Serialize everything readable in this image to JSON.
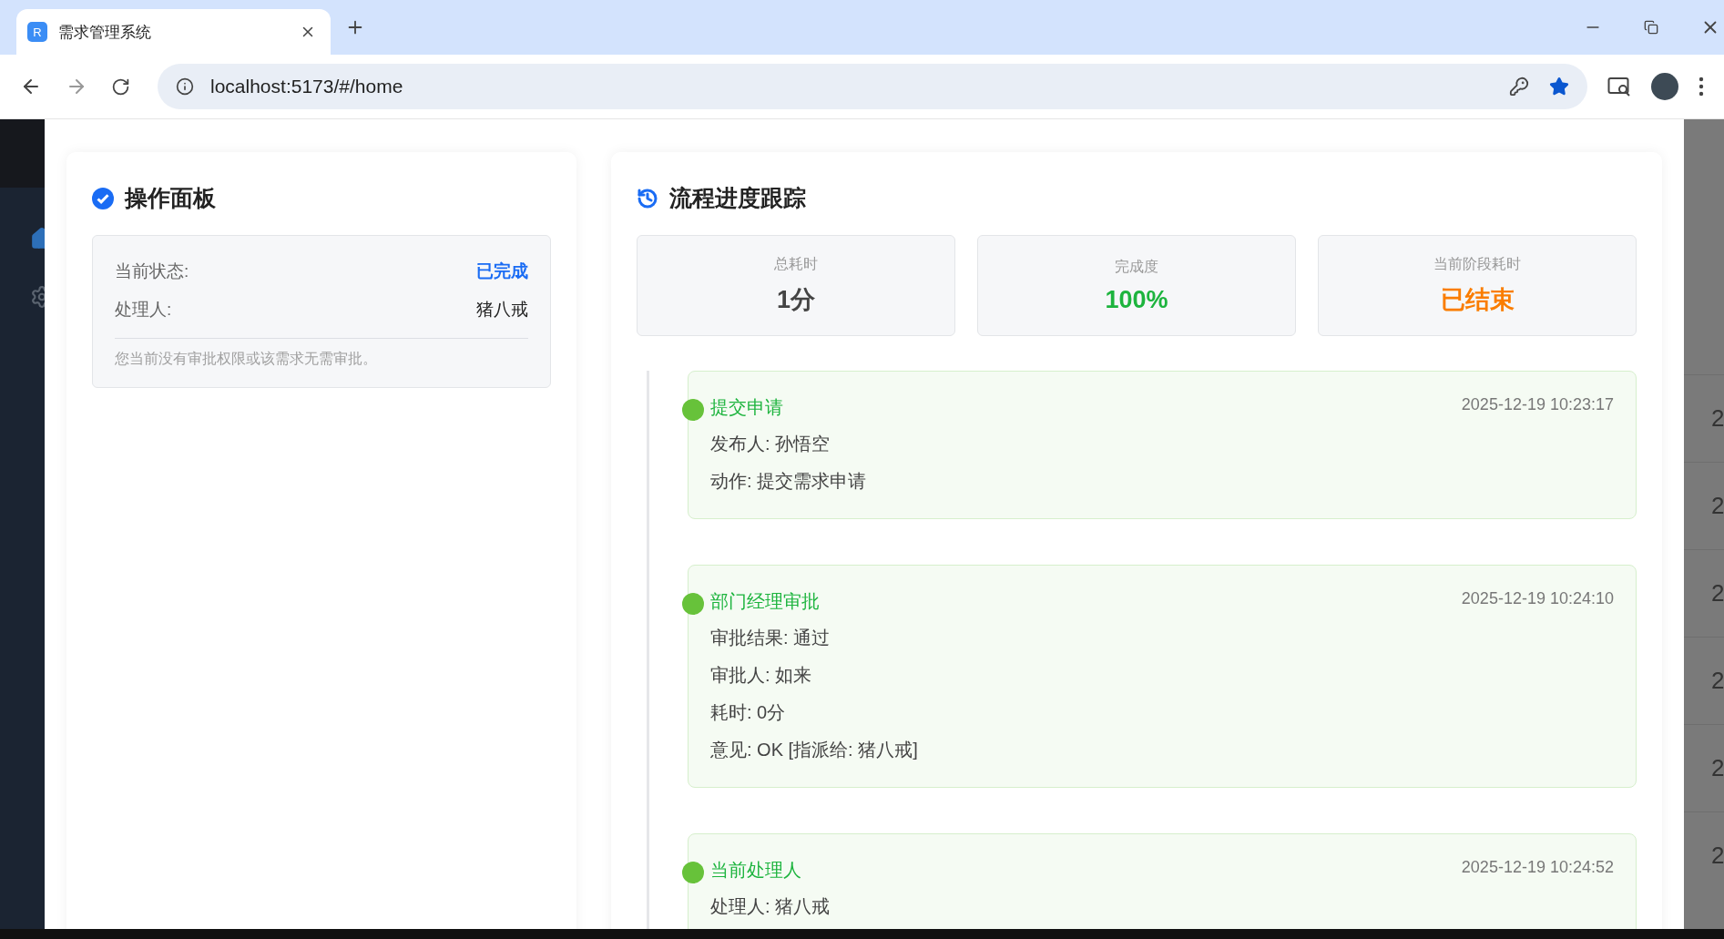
{
  "browser": {
    "tab": {
      "favicon": "R",
      "title": "需求管理系统",
      "selected": true
    },
    "url": "localhost:5173/#/home"
  },
  "operation_panel": {
    "title": "操作面板",
    "status_label": "当前状态:",
    "status_value": "已完成",
    "handler_label": "处理人:",
    "handler_value": "猪八戒",
    "note": "您当前没有审批权限或该需求无需审批。"
  },
  "progress": {
    "title": "流程进度跟踪",
    "stats": [
      {
        "label": "总耗时",
        "value": "1分",
        "color": "#444444"
      },
      {
        "label": "完成度",
        "value": "100%",
        "color": "#1db43e"
      },
      {
        "label": "当前阶段耗时",
        "value": "已结束",
        "color": "#fa7d00"
      }
    ],
    "timeline": [
      {
        "title": "提交申请",
        "time": "2025-12-19 10:23:17",
        "color": "#67c23a",
        "lines": [
          "发布人: 孙悟空",
          "动作: 提交需求申请"
        ]
      },
      {
        "title": "部门经理审批",
        "time": "2025-12-19 10:24:10",
        "color": "#67c23a",
        "lines": [
          "审批结果: 通过",
          "审批人: 如来",
          "耗时: 0分",
          "意见: OK [指派给: 猪八戒]"
        ]
      },
      {
        "title": "当前处理人",
        "time": "2025-12-19 10:24:52",
        "color": "#67c23a",
        "lines": [
          "处理人: 猪八戒"
        ]
      }
    ]
  },
  "background_table": {
    "cells": [
      "2",
      "2",
      "2",
      "2",
      "2",
      "2"
    ]
  }
}
